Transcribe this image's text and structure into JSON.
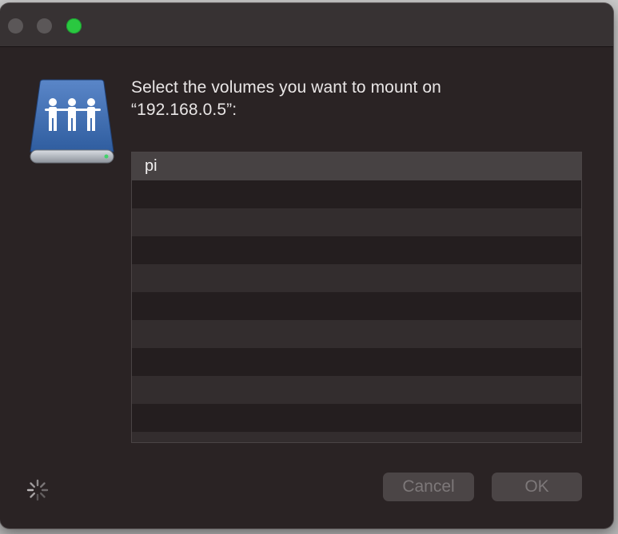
{
  "window": {
    "title": ""
  },
  "dialog": {
    "prompt": "Select the volumes you want to mount on\n“192.168.0.5”:",
    "icon": "shared-server-drive-icon"
  },
  "volumes": [
    {
      "label": "pi",
      "selected": true
    },
    {
      "label": ""
    },
    {
      "label": ""
    },
    {
      "label": ""
    },
    {
      "label": ""
    },
    {
      "label": ""
    },
    {
      "label": ""
    },
    {
      "label": ""
    },
    {
      "label": ""
    },
    {
      "label": ""
    },
    {
      "label": ""
    }
  ],
  "buttons": {
    "cancel": "Cancel",
    "ok": "OK"
  },
  "status": {
    "spinner": "progress-spinner-icon"
  },
  "colors": {
    "window_bg": "#2a2324",
    "titlebar_bg": "#373233",
    "zoom_green": "#2ac840",
    "button_bg": "#4b4546",
    "button_text_disabled": "#7d7879"
  }
}
